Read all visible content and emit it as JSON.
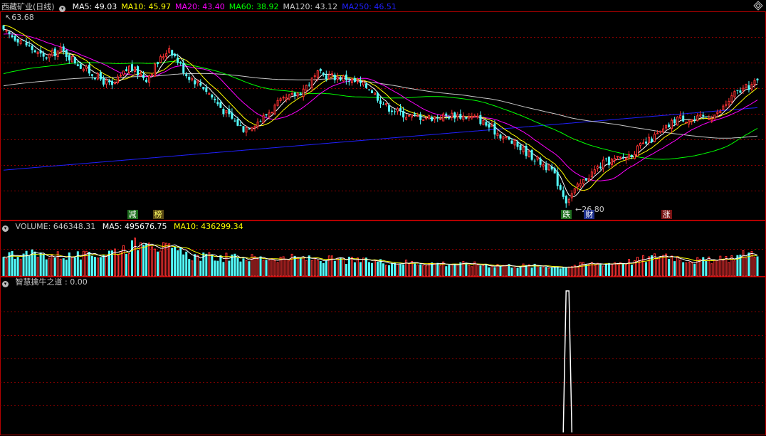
{
  "header": {
    "stock_title": "西藏矿业(日线)",
    "ma_labels": [
      {
        "text": "MA5: 49.03",
        "color": "#ffffff"
      },
      {
        "text": "MA10: 45.97",
        "color": "#ffff00"
      },
      {
        "text": "MA20: 43.40",
        "color": "#ff00ff"
      },
      {
        "text": "MA60: 38.92",
        "color": "#00ff00"
      },
      {
        "text": "MA120: 43.12",
        "color": "#c8c8c8"
      },
      {
        "text": "MA250: 46.51",
        "color": "#2020ff"
      }
    ]
  },
  "annotations": {
    "high": "63.68",
    "low": "26.80",
    "markers": [
      {
        "text": "减",
        "bg": "#1e6e1e",
        "fg": "#ffffff",
        "bar": 45
      },
      {
        "text": "榜",
        "bg": "#5a4a14",
        "fg": "#ffff66",
        "bar": 54
      },
      {
        "text": "跌",
        "bg": "#1e6e1e",
        "fg": "#ffffff",
        "bar": 197
      },
      {
        "text": "财",
        "bg": "#1c2f8c",
        "fg": "#ffffff",
        "bar": 205
      },
      {
        "text": "涨",
        "bg": "#7a1414",
        "fg": "#ffffff",
        "bar": 232
      }
    ]
  },
  "volume_header": {
    "title": "VOLUME: 646348.31",
    "ma5": "MA5: 495676.75",
    "ma10": "MA10: 436299.34"
  },
  "indicator_header": {
    "title": "智慧擒牛之道 : 0.00"
  },
  "colors": {
    "up": "#ff3232",
    "down": "#54ffff",
    "grid": "#8b0000",
    "separator": "#b40000",
    "ma5": "#ffffff",
    "ma10": "#ffff00",
    "ma20": "#ff00ff",
    "ma60": "#00ff00",
    "ma120": "#c8c8c8",
    "ma250": "#2020ff"
  },
  "chart_data": {
    "type": "candlestick",
    "price_range": [
      24.4,
      65.5
    ],
    "n_bars": 265,
    "anchors": [
      [
        0,
        61.5
      ],
      [
        6,
        60
      ],
      [
        14,
        56.3
      ],
      [
        20,
        58
      ],
      [
        28,
        54.3
      ],
      [
        38,
        50.5
      ],
      [
        44,
        54.5
      ],
      [
        50,
        52.2
      ],
      [
        58,
        58.5
      ],
      [
        64,
        53
      ],
      [
        70,
        50.5
      ],
      [
        78,
        45
      ],
      [
        84,
        42
      ],
      [
        90,
        43.8
      ],
      [
        96,
        47
      ],
      [
        104,
        49.5
      ],
      [
        110,
        53
      ],
      [
        120,
        52.2
      ],
      [
        128,
        50.3
      ],
      [
        134,
        46.5
      ],
      [
        142,
        44.5
      ],
      [
        150,
        44.3
      ],
      [
        158,
        44.8
      ],
      [
        166,
        44.1
      ],
      [
        172,
        41.5
      ],
      [
        180,
        38.5
      ],
      [
        186,
        36
      ],
      [
        192,
        33.5
      ],
      [
        197,
        27.5
      ],
      [
        204,
        32
      ],
      [
        210,
        35
      ],
      [
        218,
        36.3
      ],
      [
        226,
        39.5
      ],
      [
        232,
        42
      ],
      [
        236,
        44.3
      ],
      [
        242,
        43.8
      ],
      [
        250,
        45
      ],
      [
        256,
        49
      ],
      [
        264,
        51.5
      ]
    ],
    "volume_range": [
      0,
      1000000
    ],
    "volume_anchors": [
      [
        0,
        540000
      ],
      [
        10,
        520000
      ],
      [
        18,
        500000
      ],
      [
        30,
        480000
      ],
      [
        38,
        600000
      ],
      [
        44,
        720000
      ],
      [
        48,
        800000
      ],
      [
        50,
        1050000
      ],
      [
        54,
        720000
      ],
      [
        58,
        640000
      ],
      [
        66,
        480000
      ],
      [
        80,
        440000
      ],
      [
        100,
        430000
      ],
      [
        120,
        380000
      ],
      [
        140,
        330000
      ],
      [
        160,
        290000
      ],
      [
        180,
        250000
      ],
      [
        196,
        230000
      ],
      [
        205,
        290000
      ],
      [
        220,
        350000
      ],
      [
        232,
        520000
      ],
      [
        240,
        380000
      ],
      [
        250,
        370000
      ],
      [
        264,
        600000
      ]
    ],
    "indicator_range": [
      0,
      1
    ],
    "indicator_spike": {
      "start": 196,
      "peak_start": 197,
      "peak_end": 198,
      "end": 199,
      "value": 1
    },
    "indicator_value": 0.0
  }
}
